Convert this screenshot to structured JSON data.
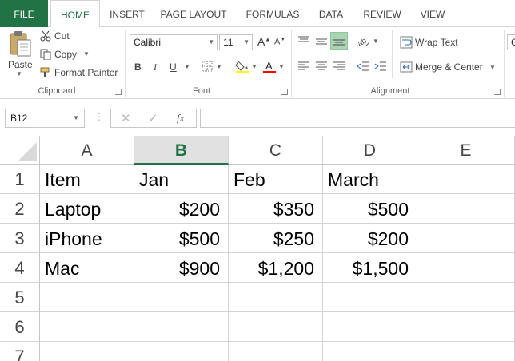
{
  "ribbon_tabs": [
    "FILE",
    "HOME",
    "INSERT",
    "PAGE LAYOUT",
    "FORMULAS",
    "DATA",
    "REVIEW",
    "VIEW"
  ],
  "clipboard": {
    "paste": "Paste",
    "cut": "Cut",
    "copy": "Copy",
    "format_painter": "Format Painter",
    "label": "Clipboard"
  },
  "font": {
    "family": "Calibri",
    "size": "11",
    "bold": "B",
    "italic": "I",
    "underline": "U",
    "font_color_letter": "A",
    "grow_letter": "A",
    "shrink_letter": "A",
    "label": "Font"
  },
  "alignment": {
    "wrap_text": "Wrap Text",
    "merge_center": "Merge & Center",
    "label": "Alignment"
  },
  "number_partial": "G",
  "formula_bar": {
    "name_box": "B12",
    "fx": "fx",
    "value": ""
  },
  "columns": [
    "A",
    "B",
    "C",
    "D",
    "E"
  ],
  "selected_column": "B",
  "rows": [
    "1",
    "2",
    "3",
    "4",
    "5",
    "6",
    "7"
  ],
  "cells": [
    [
      "Item",
      "Jan",
      "Feb",
      "March"
    ],
    [
      "Laptop",
      "$200",
      "$350",
      "$500"
    ],
    [
      "iPhone",
      "$500",
      "$250",
      "$200"
    ],
    [
      "Mac",
      "$900",
      "$1,200",
      "$1,500"
    ]
  ],
  "colors": {
    "accent": "#217346",
    "font_color_bar": "#ff0000",
    "highlight_bar": "#ffff00"
  }
}
